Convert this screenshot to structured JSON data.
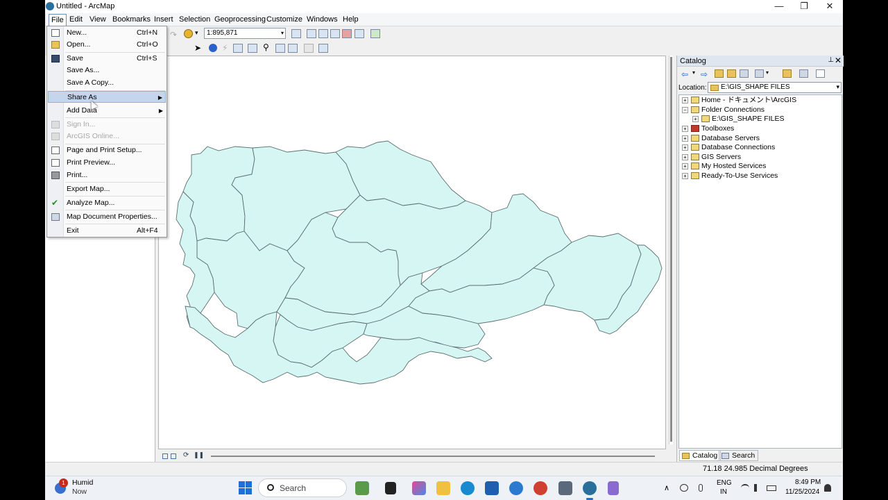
{
  "window": {
    "title": "Untitled - ArcMap",
    "min_glyph": "—",
    "max_glyph": "❐",
    "close_glyph": "✕"
  },
  "menubar": {
    "items": [
      "File",
      "Edit",
      "View",
      "Bookmarks",
      "Insert",
      "Selection",
      "Geoprocessing",
      "Customize",
      "Windows",
      "Help"
    ],
    "active": "File"
  },
  "toolbar": {
    "scale": "1:895,871",
    "dropdown_glyph": "▾"
  },
  "file_menu": {
    "items": [
      {
        "label": "New...",
        "shortcut": "Ctrl+N",
        "icon": "new-document-icon",
        "disabled": false
      },
      {
        "label": "Open...",
        "shortcut": "Ctrl+O",
        "icon": "open-folder-icon",
        "disabled": false
      },
      {
        "label": "Save",
        "shortcut": "Ctrl+S",
        "icon": "save-disk-icon",
        "disabled": false
      },
      {
        "label": "Save As...",
        "shortcut": "",
        "icon": "",
        "disabled": false
      },
      {
        "label": "Save A Copy...",
        "shortcut": "",
        "icon": "",
        "disabled": false
      },
      {
        "label": "Share As",
        "shortcut": "",
        "icon": "",
        "disabled": false,
        "submenu": true,
        "highlighted": true
      },
      {
        "label": "Add Data",
        "shortcut": "",
        "icon": "",
        "disabled": false,
        "submenu": true
      },
      {
        "label": "Sign In...",
        "shortcut": "",
        "icon": "sign-in-icon",
        "disabled": true
      },
      {
        "label": "ArcGIS Online...",
        "shortcut": "",
        "icon": "arcgis-online-icon",
        "disabled": true
      },
      {
        "label": "Page and Print Setup...",
        "shortcut": "",
        "icon": "page-setup-icon",
        "disabled": false
      },
      {
        "label": "Print Preview...",
        "shortcut": "",
        "icon": "print-preview-icon",
        "disabled": false
      },
      {
        "label": "Print...",
        "shortcut": "",
        "icon": "printer-icon",
        "disabled": false
      },
      {
        "label": "Export Map...",
        "shortcut": "",
        "icon": "",
        "disabled": false
      },
      {
        "label": "Analyze Map...",
        "shortcut": "",
        "icon": "analyze-check-icon",
        "disabled": false
      },
      {
        "label": "Map Document Properties...",
        "shortcut": "",
        "icon": "document-properties-icon",
        "disabled": false
      },
      {
        "label": "Exit",
        "shortcut": "Alt+F4",
        "icon": "",
        "disabled": false
      }
    ],
    "submenu_glyph": "▶"
  },
  "catalog": {
    "title": "Catalog",
    "pin_glyph": "⊥",
    "close_glyph": "✕",
    "location_label": "Location:",
    "location_value": "E:\\GIS_SHAPE FILES",
    "tree": [
      {
        "label": "Home - ドキュメント\\ArcGIS",
        "level": 0,
        "expander": "+",
        "icon": "home-folder-icon"
      },
      {
        "label": "Folder Connections",
        "level": 0,
        "expander": "−",
        "icon": "folder-connections-icon"
      },
      {
        "label": "E:\\GIS_SHAPE FILES",
        "level": 1,
        "expander": "+",
        "icon": "folder-icon"
      },
      {
        "label": "Toolboxes",
        "level": 0,
        "expander": "+",
        "icon": "toolbox-icon"
      },
      {
        "label": "Database Servers",
        "level": 0,
        "expander": "+",
        "icon": "database-server-icon"
      },
      {
        "label": "Database Connections",
        "level": 0,
        "expander": "+",
        "icon": "database-connection-icon"
      },
      {
        "label": "GIS Servers",
        "level": 0,
        "expander": "+",
        "icon": "gis-server-icon"
      },
      {
        "label": "My Hosted Services",
        "level": 0,
        "expander": "+",
        "icon": "hosted-services-icon"
      },
      {
        "label": "Ready-To-Use Services",
        "level": 0,
        "expander": "+",
        "icon": "ready-services-icon"
      }
    ],
    "tabs": [
      "Catalog",
      "Search"
    ]
  },
  "statusbar": {
    "coordinates": "71.18  24.985 Decimal Degrees"
  },
  "map": {
    "fill_color": "#d6f6f4",
    "stroke_color": "#5a6e70"
  },
  "taskbar": {
    "weather_title": "Humid",
    "weather_sub": "Now",
    "weather_badge": "1",
    "search_placeholder": "Search",
    "lang_1": "ENG",
    "lang_2": "IN",
    "time": "8:49 PM",
    "date": "11/25/2024",
    "chevron_glyph": "∧"
  }
}
